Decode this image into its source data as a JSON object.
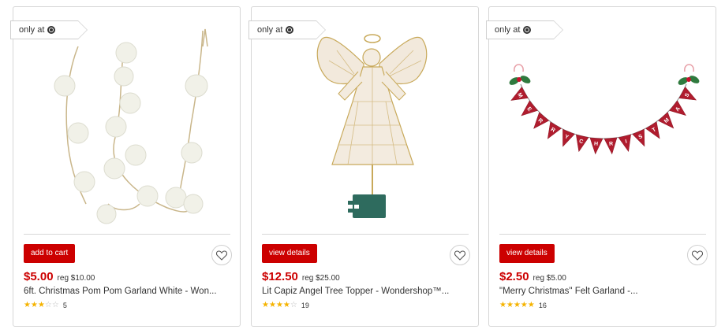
{
  "colors": {
    "accent": "#cc0000",
    "star": "#f5b300",
    "border": "#d6d6d6"
  },
  "products": [
    {
      "badge": "only at",
      "cta_label": "add to cart",
      "price": "$5.00",
      "reg_price": "reg $10.00",
      "title": "6ft. Christmas Pom Pom Garland White - Won...",
      "rating": 3,
      "rating_max": 5,
      "review_count": "5"
    },
    {
      "badge": "only at",
      "cta_label": "view details",
      "price": "$12.50",
      "reg_price": "reg $25.00",
      "title": "Lit Capiz Angel Tree Topper - Wondershop™...",
      "rating": 4,
      "rating_max": 5,
      "review_count": "19"
    },
    {
      "badge": "only at",
      "cta_label": "view details",
      "price": "$2.50",
      "reg_price": "reg $5.00",
      "title": "\"Merry Christmas\" Felt Garland -...",
      "rating": 5,
      "rating_max": 5,
      "review_count": "16",
      "banner_letters": [
        "M",
        "E",
        "R",
        "R",
        "Y",
        "C",
        "H",
        "R",
        "I",
        "S",
        "T",
        "M",
        "A",
        "S"
      ]
    }
  ]
}
